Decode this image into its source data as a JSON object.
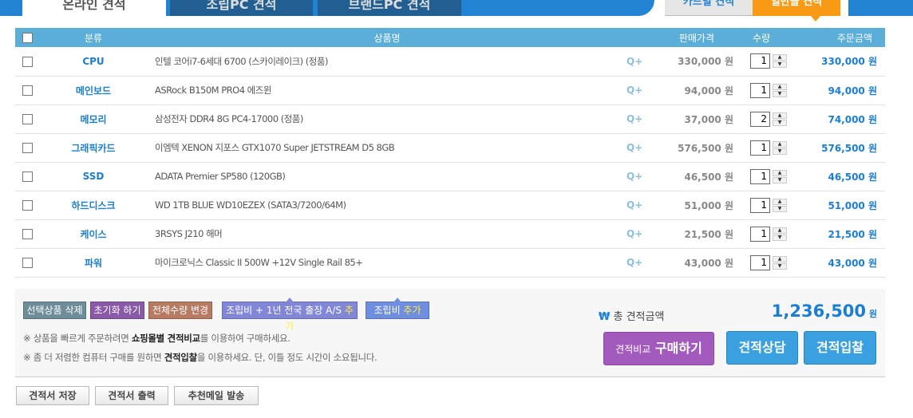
{
  "top_tabs": [
    {
      "label": "온라인 견적"
    },
    {
      "label": "조립PC 견적"
    },
    {
      "label": "브랜드PC 견적"
    }
  ],
  "right_tabs": [
    {
      "label": "카드별 견적"
    },
    {
      "label": "일반몰 견적"
    }
  ],
  "table": {
    "headers": {
      "category": "분류",
      "name": "상품명",
      "price": "판매가격",
      "qty": "수량",
      "total": "주문금액"
    },
    "rows": [
      {
        "category": "CPU",
        "name": "인텔 코어i7-6세대 6700 (스카이레이크) (정품)",
        "price": "330,000 원",
        "qty": "1",
        "total": "330,000 원"
      },
      {
        "category": "메인보드",
        "name": "ASRock B150M PRO4 에즈윈",
        "price": "94,000 원",
        "qty": "1",
        "total": "94,000 원"
      },
      {
        "category": "메모리",
        "name": "삼성전자 DDR4 8G PC4-17000 (정품)",
        "price": "37,000 원",
        "qty": "2",
        "total": "74,000 원"
      },
      {
        "category": "그래픽카드",
        "name": "이엠텍 XENON 지포스 GTX1070 Super JETSTREAM D5 8GB",
        "price": "576,500 원",
        "qty": "1",
        "total": "576,500 원"
      },
      {
        "category": "SSD",
        "name": "ADATA Premier SP580 (120GB)",
        "price": "46,500 원",
        "qty": "1",
        "total": "46,500 원"
      },
      {
        "category": "하드디스크",
        "name": "WD 1TB BLUE WD10EZEX (SATA3/7200/64M)",
        "price": "51,000 원",
        "qty": "1",
        "total": "51,000 원"
      },
      {
        "category": "케이스",
        "name": "3RSYS J210 해머",
        "price": "21,500 원",
        "qty": "1",
        "total": "21,500 원"
      },
      {
        "category": "파워",
        "name": "마이크로닉스 Classic II 500W +12V Single Rail 85+",
        "price": "43,000 원",
        "qty": "1",
        "total": "43,000 원"
      }
    ],
    "zoom_label": "Q+"
  },
  "actions": {
    "delete": "선택상품 삭제",
    "reset": "초기화 하기",
    "change_qty": "전체수량 변경",
    "assembly_as": "조립비 + 1년 전국 출장 A/S ",
    "assembly": "조립비 ",
    "add": "추가"
  },
  "notes": {
    "n1_pre": "※ 상품을 빠르게 주문하려면 ",
    "n1_bold": "쇼핑몰별 견적비교",
    "n1_post": "를 이용하여 구매하세요.",
    "n2_pre": "※ 좀 더 저렴한 컴퓨터 구매를 원하면 ",
    "n2_bold": "견적입찰",
    "n2_post": "을 이용하세요. 단, 이틀 정도 시간이 소요됩니다."
  },
  "summary": {
    "currency_symbol": "₩",
    "label": "총 견적금액",
    "amount": "1,236,500",
    "unit": "원"
  },
  "buy": {
    "small": "견적비교",
    "big": "구매하기"
  },
  "consult": "견적상담",
  "bid": "견적입찰",
  "footer": {
    "save": "견적서 저장",
    "print": "견적서 출력",
    "mail": "추천메일 발송"
  },
  "colors": {
    "accent": "#1a7fd4",
    "header": "#5aaed7",
    "orange": "#f99a14"
  }
}
